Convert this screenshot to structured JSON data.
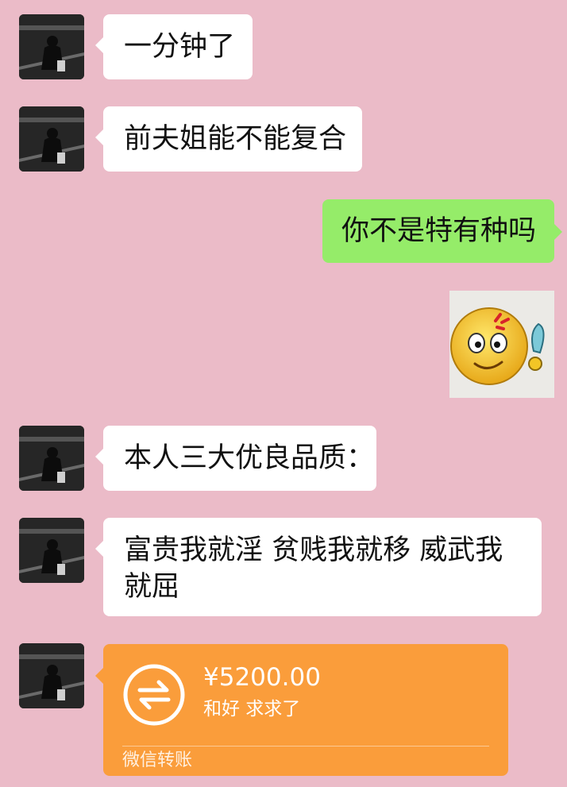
{
  "messages": [
    {
      "side": "left",
      "text": "一分钟了"
    },
    {
      "side": "left",
      "text": "前夫姐能不能复合"
    },
    {
      "side": "right",
      "text": "你不是特有种吗"
    },
    {
      "side": "right",
      "sticker": "angry-smiley-sticker"
    },
    {
      "side": "left",
      "text": "本人三大优良品质："
    },
    {
      "side": "left",
      "text": "富贵我就淫 贫贱我就移 威武我就屈"
    }
  ],
  "transfer": {
    "amount": "¥5200.00",
    "note": "和好 求求了",
    "footer": "微信转账",
    "icon": "transfer-arrows-icon",
    "color": "#fa9d3b"
  },
  "colors": {
    "background": "#ebbbc8",
    "left_bubble": "#ffffff",
    "right_bubble": "#95ec69"
  }
}
